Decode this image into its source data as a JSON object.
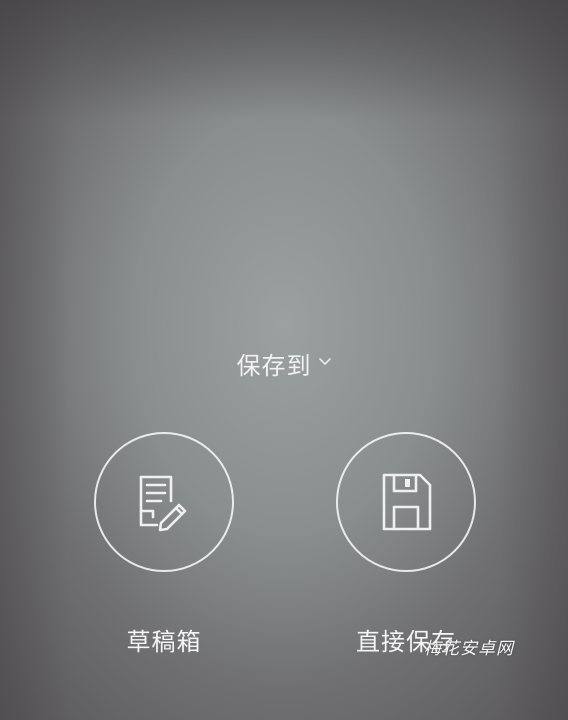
{
  "save_to": {
    "label": "保存到",
    "chevron_icon": "chevron-down-icon"
  },
  "actions": [
    {
      "label": "草稿箱",
      "icon": "draft-edit-icon"
    },
    {
      "label": "直接保存",
      "icon": "floppy-disk-icon"
    }
  ],
  "watermark": {
    "text": "梅花安卓网"
  },
  "colors": {
    "background_center": "#979b9b",
    "background_edge": "#545254",
    "foreground": "#f5f5f5"
  }
}
